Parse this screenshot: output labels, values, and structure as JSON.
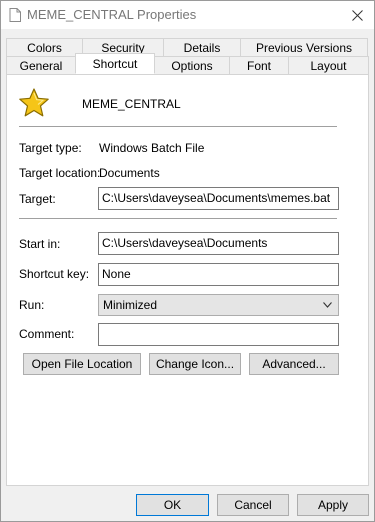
{
  "window": {
    "title": "MEME_CENTRAL Properties"
  },
  "tabs_row1": [
    "Colors",
    "Security",
    "Details",
    "Previous Versions"
  ],
  "tabs_row2": [
    "General",
    "Shortcut",
    "Options",
    "Font",
    "Layout"
  ],
  "active_tab": "Shortcut",
  "header": {
    "name": "MEME_CENTRAL",
    "icon": "star-icon"
  },
  "info": {
    "target_type_label": "Target type:",
    "target_type_value": "Windows Batch File",
    "target_location_label": "Target location:",
    "target_location_value": "Documents",
    "target_label": "Target:",
    "target_value": "C:\\Users\\daveysea\\Documents\\memes.bat"
  },
  "fields": {
    "start_in_label": "Start in:",
    "start_in_value": "C:\\Users\\daveysea\\Documents",
    "shortcut_key_label": "Shortcut key:",
    "shortcut_key_value": "None",
    "run_label": "Run:",
    "run_value": "Minimized",
    "comment_label": "Comment:",
    "comment_value": ""
  },
  "buttons": {
    "open_file_location": "Open File Location",
    "change_icon": "Change Icon...",
    "advanced": "Advanced..."
  },
  "footer": {
    "ok": "OK",
    "cancel": "Cancel",
    "apply": "Apply"
  },
  "colors": {
    "accent": "#0078d7",
    "star": "#f5c518"
  }
}
